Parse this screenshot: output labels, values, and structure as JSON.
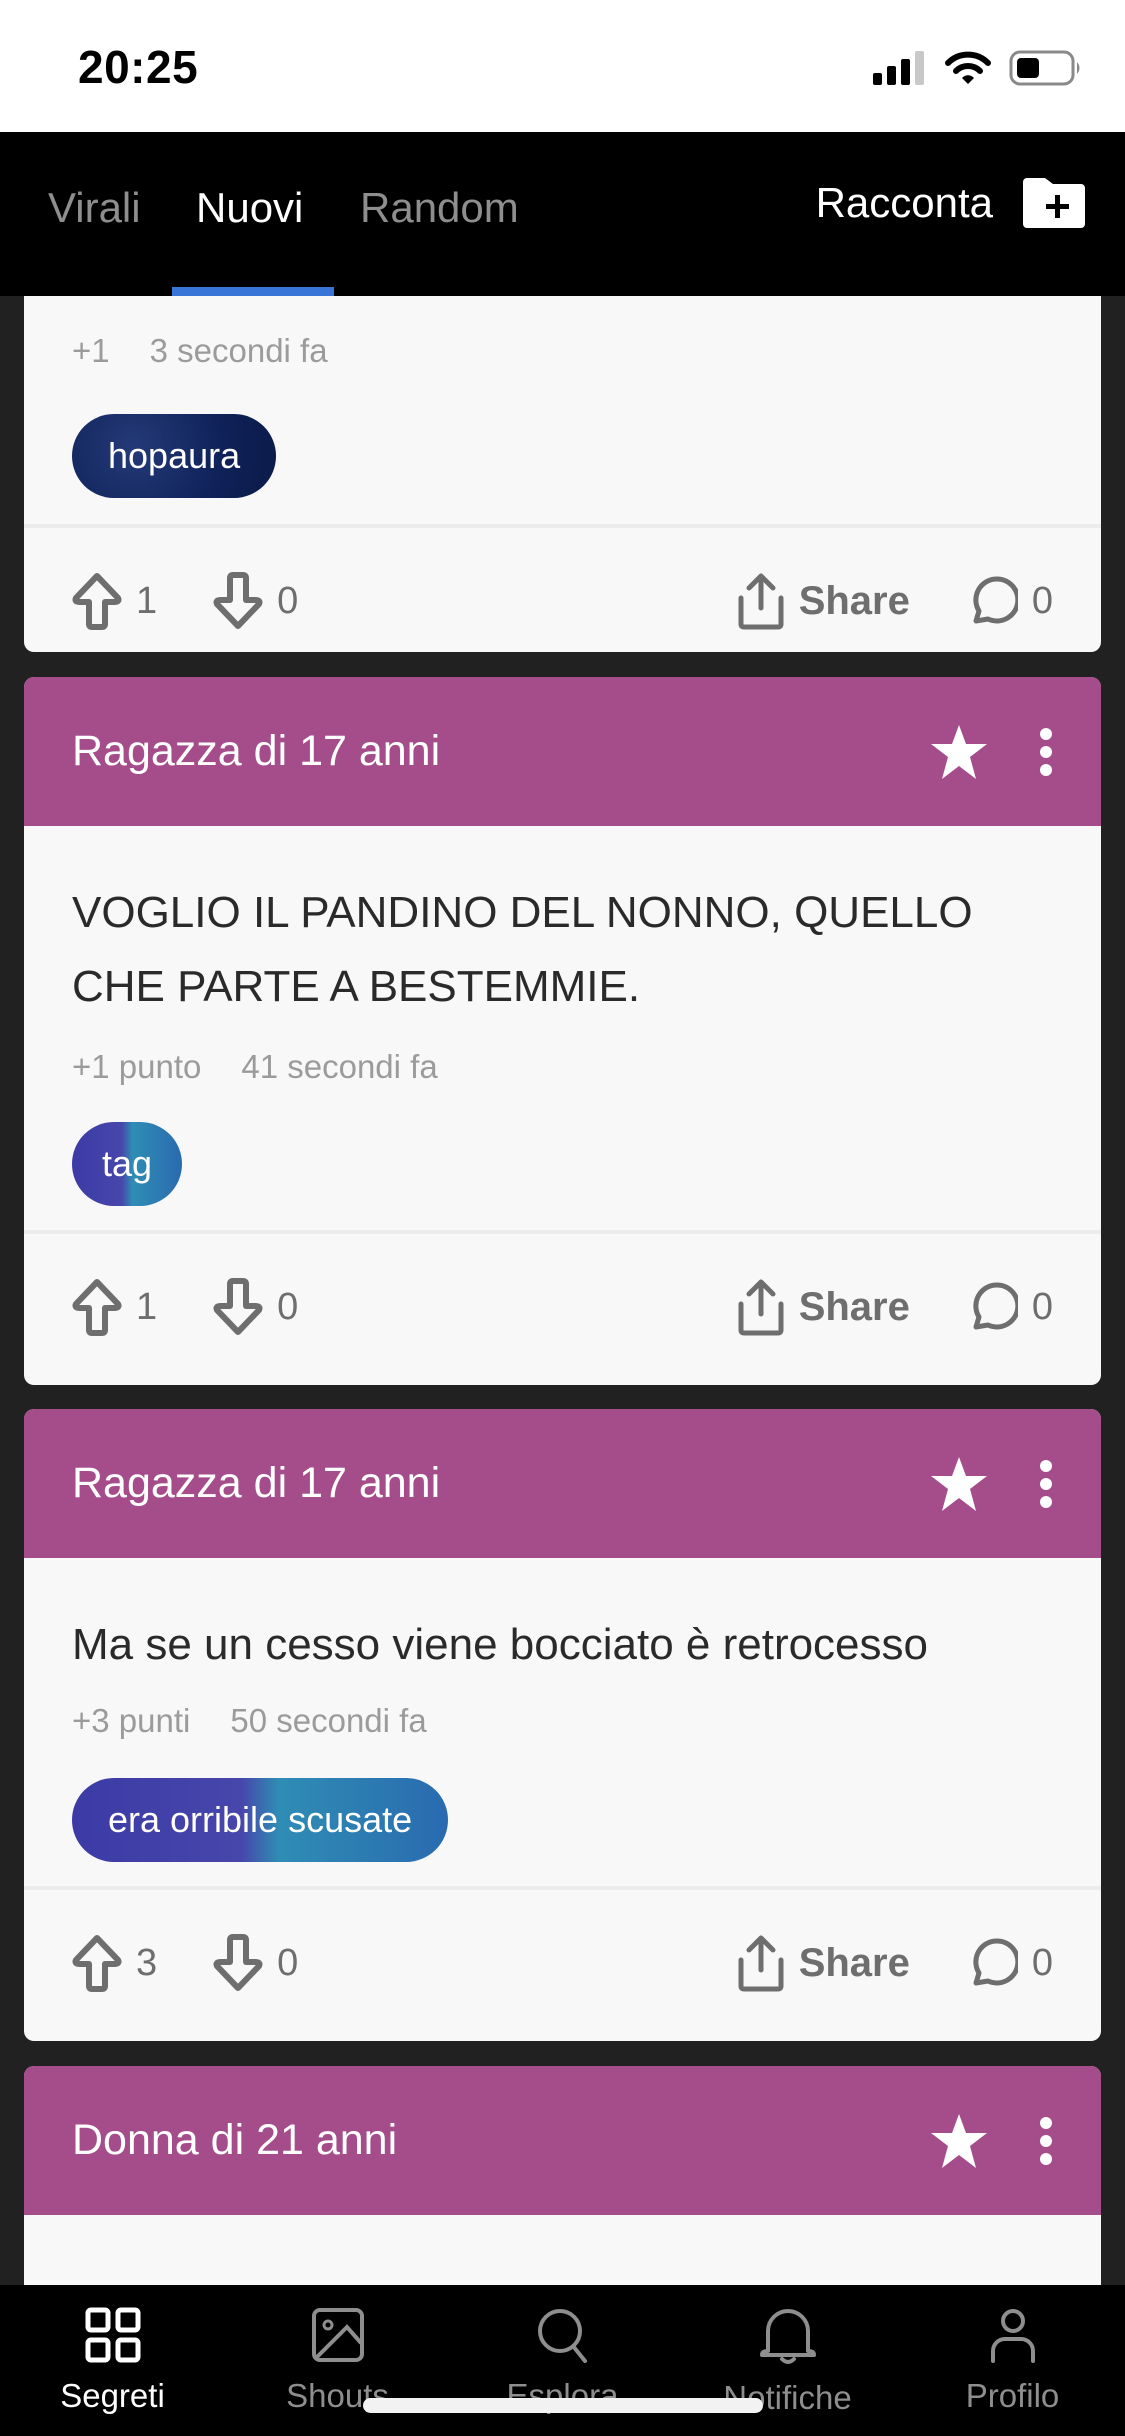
{
  "status_bar": {
    "time": "20:25",
    "battery_level": 0.35
  },
  "top_tabs": {
    "tabs": [
      {
        "label": "Virali",
        "active": false
      },
      {
        "label": "Nuovi",
        "active": true
      },
      {
        "label": "Random",
        "active": false
      }
    ],
    "create_label": "Racconta"
  },
  "colors": {
    "accent": "#3875d7",
    "card_header": "#a54d8a",
    "background": "#212121"
  },
  "posts": [
    {
      "author": "",
      "text": "",
      "points": "+1",
      "time": "3 secondi fa",
      "tag": "hopaura",
      "upvotes": "1",
      "downvotes": "0",
      "share_label": "Share",
      "comments": "0"
    },
    {
      "author": "Ragazza di 17 anni",
      "text": "VOGLIO IL PANDINO DEL NONNO, QUELLO CHE PARTE A BESTEMMIE.",
      "points": "+1 punto",
      "time": "41 secondi fa",
      "tag": "tag",
      "upvotes": "1",
      "downvotes": "0",
      "share_label": "Share",
      "comments": "0"
    },
    {
      "author": "Ragazza di 17 anni",
      "text": "Ma se un cesso viene bocciato è retrocesso",
      "points": "+3 punti",
      "time": "50 secondi fa",
      "tag": "era orribile scusate",
      "upvotes": "3",
      "downvotes": "0",
      "share_label": "Share",
      "comments": "0"
    },
    {
      "author": "Donna di 21 anni"
    }
  ],
  "bottom_nav": [
    {
      "label": "Segreti",
      "icon": "grid-icon",
      "active": true
    },
    {
      "label": "Shouts",
      "icon": "image-icon",
      "active": false
    },
    {
      "label": "Esplora",
      "icon": "search-icon",
      "active": false
    },
    {
      "label": "Notifiche",
      "icon": "bell-icon",
      "active": false
    },
    {
      "label": "Profilo",
      "icon": "person-icon",
      "active": false
    }
  ]
}
